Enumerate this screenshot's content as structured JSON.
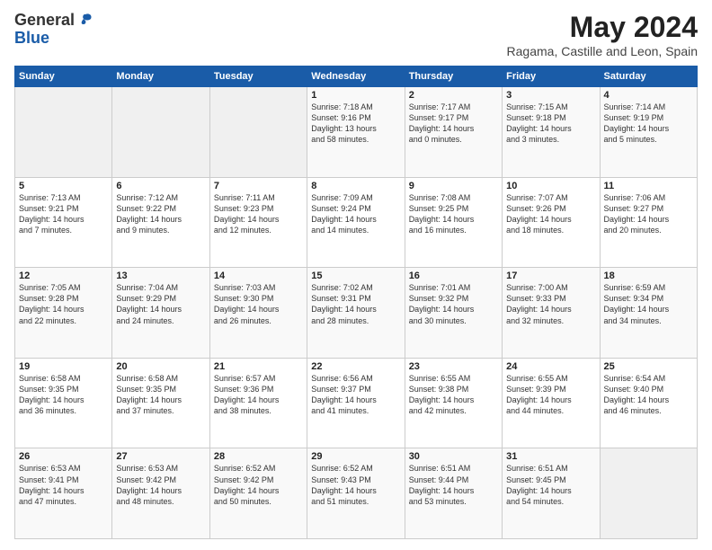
{
  "header": {
    "logo_general": "General",
    "logo_blue": "Blue",
    "month_year": "May 2024",
    "location": "Ragama, Castille and Leon, Spain"
  },
  "days_of_week": [
    "Sunday",
    "Monday",
    "Tuesday",
    "Wednesday",
    "Thursday",
    "Friday",
    "Saturday"
  ],
  "weeks": [
    [
      {
        "day": "",
        "info": ""
      },
      {
        "day": "",
        "info": ""
      },
      {
        "day": "",
        "info": ""
      },
      {
        "day": "1",
        "info": "Sunrise: 7:18 AM\nSunset: 9:16 PM\nDaylight: 13 hours\nand 58 minutes."
      },
      {
        "day": "2",
        "info": "Sunrise: 7:17 AM\nSunset: 9:17 PM\nDaylight: 14 hours\nand 0 minutes."
      },
      {
        "day": "3",
        "info": "Sunrise: 7:15 AM\nSunset: 9:18 PM\nDaylight: 14 hours\nand 3 minutes."
      },
      {
        "day": "4",
        "info": "Sunrise: 7:14 AM\nSunset: 9:19 PM\nDaylight: 14 hours\nand 5 minutes."
      }
    ],
    [
      {
        "day": "5",
        "info": "Sunrise: 7:13 AM\nSunset: 9:21 PM\nDaylight: 14 hours\nand 7 minutes."
      },
      {
        "day": "6",
        "info": "Sunrise: 7:12 AM\nSunset: 9:22 PM\nDaylight: 14 hours\nand 9 minutes."
      },
      {
        "day": "7",
        "info": "Sunrise: 7:11 AM\nSunset: 9:23 PM\nDaylight: 14 hours\nand 12 minutes."
      },
      {
        "day": "8",
        "info": "Sunrise: 7:09 AM\nSunset: 9:24 PM\nDaylight: 14 hours\nand 14 minutes."
      },
      {
        "day": "9",
        "info": "Sunrise: 7:08 AM\nSunset: 9:25 PM\nDaylight: 14 hours\nand 16 minutes."
      },
      {
        "day": "10",
        "info": "Sunrise: 7:07 AM\nSunset: 9:26 PM\nDaylight: 14 hours\nand 18 minutes."
      },
      {
        "day": "11",
        "info": "Sunrise: 7:06 AM\nSunset: 9:27 PM\nDaylight: 14 hours\nand 20 minutes."
      }
    ],
    [
      {
        "day": "12",
        "info": "Sunrise: 7:05 AM\nSunset: 9:28 PM\nDaylight: 14 hours\nand 22 minutes."
      },
      {
        "day": "13",
        "info": "Sunrise: 7:04 AM\nSunset: 9:29 PM\nDaylight: 14 hours\nand 24 minutes."
      },
      {
        "day": "14",
        "info": "Sunrise: 7:03 AM\nSunset: 9:30 PM\nDaylight: 14 hours\nand 26 minutes."
      },
      {
        "day": "15",
        "info": "Sunrise: 7:02 AM\nSunset: 9:31 PM\nDaylight: 14 hours\nand 28 minutes."
      },
      {
        "day": "16",
        "info": "Sunrise: 7:01 AM\nSunset: 9:32 PM\nDaylight: 14 hours\nand 30 minutes."
      },
      {
        "day": "17",
        "info": "Sunrise: 7:00 AM\nSunset: 9:33 PM\nDaylight: 14 hours\nand 32 minutes."
      },
      {
        "day": "18",
        "info": "Sunrise: 6:59 AM\nSunset: 9:34 PM\nDaylight: 14 hours\nand 34 minutes."
      }
    ],
    [
      {
        "day": "19",
        "info": "Sunrise: 6:58 AM\nSunset: 9:35 PM\nDaylight: 14 hours\nand 36 minutes."
      },
      {
        "day": "20",
        "info": "Sunrise: 6:58 AM\nSunset: 9:35 PM\nDaylight: 14 hours\nand 37 minutes."
      },
      {
        "day": "21",
        "info": "Sunrise: 6:57 AM\nSunset: 9:36 PM\nDaylight: 14 hours\nand 38 minutes."
      },
      {
        "day": "22",
        "info": "Sunrise: 6:56 AM\nSunset: 9:37 PM\nDaylight: 14 hours\nand 41 minutes."
      },
      {
        "day": "23",
        "info": "Sunrise: 6:55 AM\nSunset: 9:38 PM\nDaylight: 14 hours\nand 42 minutes."
      },
      {
        "day": "24",
        "info": "Sunrise: 6:55 AM\nSunset: 9:39 PM\nDaylight: 14 hours\nand 44 minutes."
      },
      {
        "day": "25",
        "info": "Sunrise: 6:54 AM\nSunset: 9:40 PM\nDaylight: 14 hours\nand 46 minutes."
      }
    ],
    [
      {
        "day": "26",
        "info": "Sunrise: 6:53 AM\nSunset: 9:41 PM\nDaylight: 14 hours\nand 47 minutes."
      },
      {
        "day": "27",
        "info": "Sunrise: 6:53 AM\nSunset: 9:42 PM\nDaylight: 14 hours\nand 48 minutes."
      },
      {
        "day": "28",
        "info": "Sunrise: 6:52 AM\nSunset: 9:42 PM\nDaylight: 14 hours\nand 50 minutes."
      },
      {
        "day": "29",
        "info": "Sunrise: 6:52 AM\nSunset: 9:43 PM\nDaylight: 14 hours\nand 51 minutes."
      },
      {
        "day": "30",
        "info": "Sunrise: 6:51 AM\nSunset: 9:44 PM\nDaylight: 14 hours\nand 53 minutes."
      },
      {
        "day": "31",
        "info": "Sunrise: 6:51 AM\nSunset: 9:45 PM\nDaylight: 14 hours\nand 54 minutes."
      },
      {
        "day": "",
        "info": ""
      }
    ]
  ]
}
